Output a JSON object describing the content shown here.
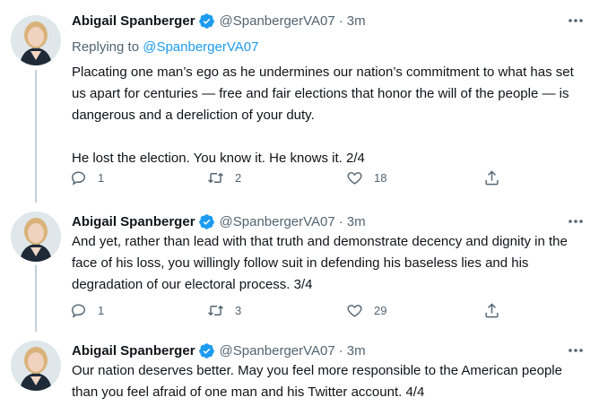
{
  "tweets": [
    {
      "name": "Abigail Spanberger",
      "handle": "@SpanbergerVA07",
      "dot": "·",
      "time": "3m",
      "reply_prefix": "Replying to ",
      "reply_to": "@SpanbergerVA07",
      "text": "Placating one man’s ego as he undermines our nation’s commitment to what has set us apart for centuries — free and fair elections that honor the will of the people — is dangerous and a dereliction of your duty.\n\nHe lost the election. You know it. He knows it. 2/4",
      "replies": "1",
      "retweets": "2",
      "likes": "18"
    },
    {
      "name": "Abigail Spanberger",
      "handle": "@SpanbergerVA07",
      "dot": "·",
      "time": "3m",
      "text": "And yet, rather than lead with that truth and demonstrate decency and dignity in the face of his loss, you willingly follow suit in defending his baseless lies and his degradation of our electoral process. 3/4",
      "replies": "1",
      "retweets": "3",
      "likes": "29"
    },
    {
      "name": "Abigail Spanberger",
      "handle": "@SpanbergerVA07",
      "dot": "·",
      "time": "3m",
      "text": "Our nation deserves better. May you feel more responsible to the American people than you feel afraid of one man and his Twitter account. 4/4"
    }
  ],
  "icons": {
    "verified": "verified-badge-icon",
    "more": "more-dots-icon",
    "reply": "reply-icon",
    "retweet": "retweet-icon",
    "like": "heart-icon",
    "share": "share-icon"
  },
  "colors": {
    "accent": "#1d9bf0",
    "text": "#0f1419",
    "secondary": "#536471"
  }
}
